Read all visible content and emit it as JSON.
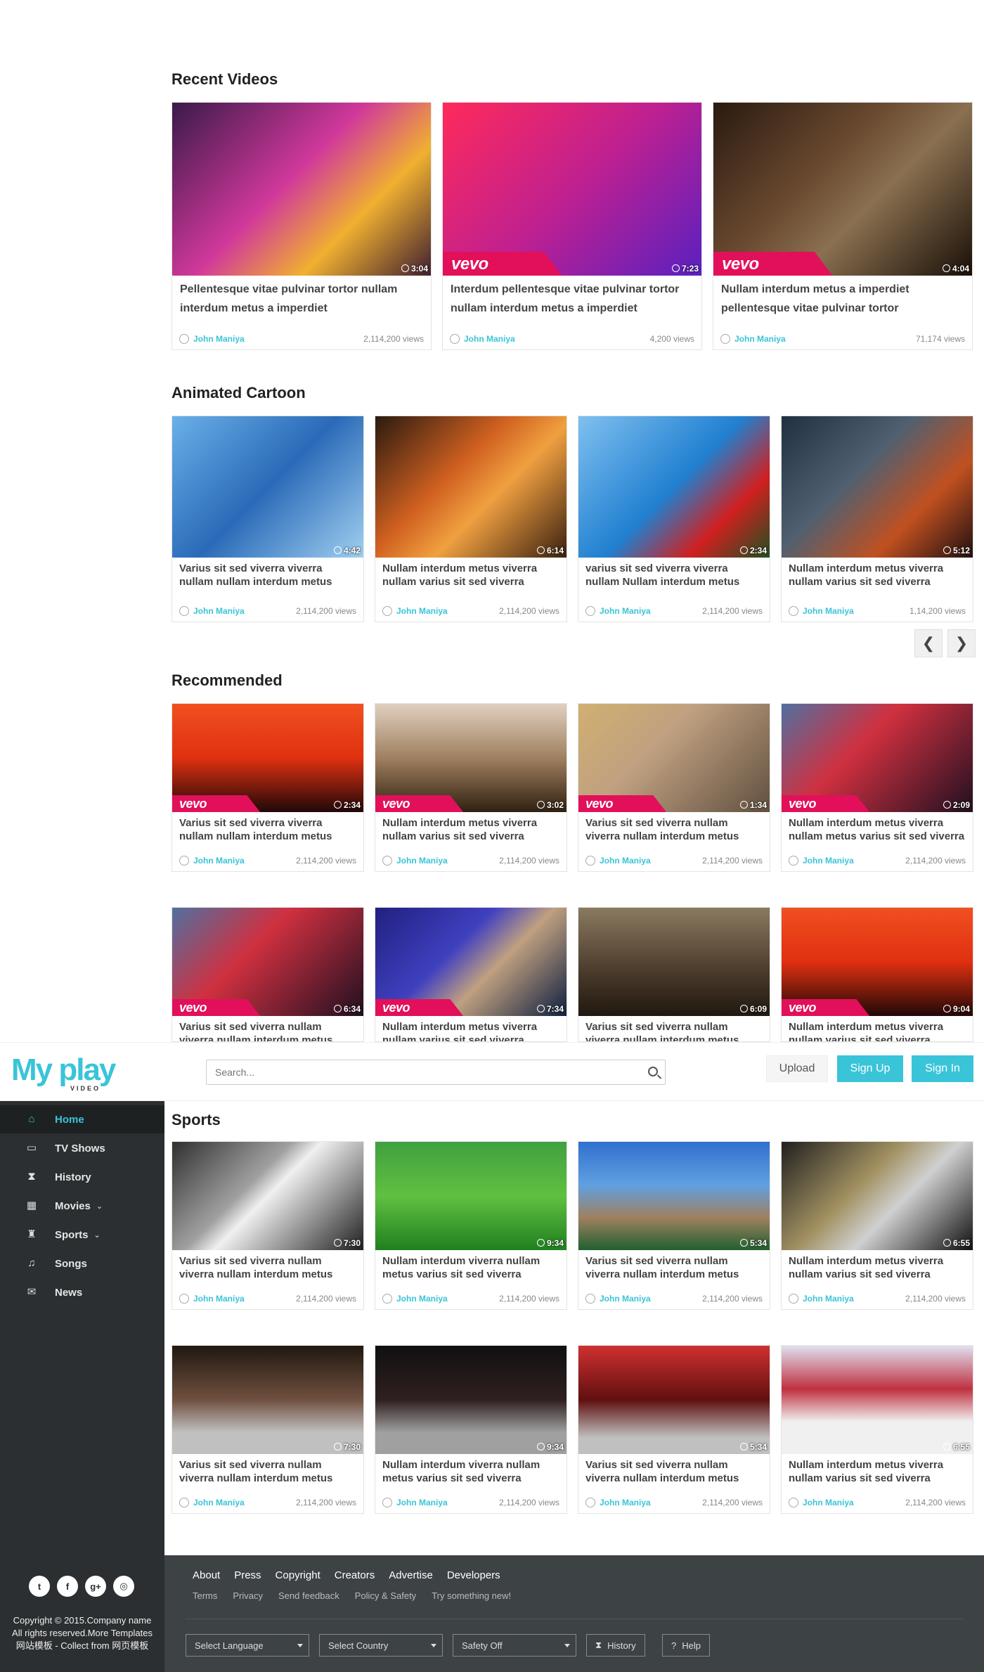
{
  "recent": {
    "title": "Recent Videos",
    "items": [
      {
        "title": "Pellentesque vitae pulvinar tortor nullam interdum metus a imperdiet",
        "author": "John Maniya",
        "views": "2,114,200 views",
        "duration": "3:04",
        "vevo": false
      },
      {
        "title": "Interdum pellentesque vitae pulvinar tortor nullam interdum metus a imperdiet",
        "author": "John Maniya",
        "views": "4,200 views",
        "duration": "7:23",
        "vevo": true
      },
      {
        "title": "Nullam interdum metus a imperdiet pellentesque vitae pulvinar tortor",
        "author": "John Maniya",
        "views": "71,174 views",
        "duration": "4:04",
        "vevo": true
      }
    ]
  },
  "cartoon": {
    "title": "Animated Cartoon",
    "items": [
      {
        "title": "Varius sit sed viverra viverra nullam nullam interdum metus",
        "author": "John Maniya",
        "views": "2,114,200 views",
        "duration": "4:42"
      },
      {
        "title": "Nullam interdum metus viverra nullam varius sit sed viverra",
        "author": "John Maniya",
        "views": "2,114,200 views",
        "duration": "6:14"
      },
      {
        "title": "varius sit sed viverra viverra nullam Nullam interdum metus",
        "author": "John Maniya",
        "views": "2,114,200 views",
        "duration": "2:34"
      },
      {
        "title": "Nullam interdum metus viverra nullam varius sit sed viverra",
        "author": "John Maniya",
        "views": "1,14,200 views",
        "duration": "5:12"
      }
    ],
    "prev": "❮",
    "next": "❯"
  },
  "recommended": {
    "title": "Recommended",
    "row1": [
      {
        "title": "Varius sit sed viverra viverra nullam nullam interdum metus",
        "author": "John Maniya",
        "views": "2,114,200 views",
        "duration": "2:34"
      },
      {
        "title": "Nullam interdum metus viverra nullam varius sit sed viverra",
        "author": "John Maniya",
        "views": "2,114,200 views",
        "duration": "3:02"
      },
      {
        "title": "Varius sit sed viverra nullam viverra nullam interdum metus",
        "author": "John Maniya",
        "views": "2,114,200 views",
        "duration": "1:34"
      },
      {
        "title": "Nullam interdum metus viverra nullam metus varius sit sed viverra",
        "author": "John Maniya",
        "views": "2,114,200 views",
        "duration": "2:09"
      }
    ],
    "row2": [
      {
        "title": "Varius sit sed viverra nullam viverra nullam interdum metus",
        "duration": "6:34"
      },
      {
        "title": "Nullam interdum metus viverra nullam varius sit sed viverra",
        "duration": "7:34"
      },
      {
        "title": "Varius sit sed viverra nullam viverra nullam interdum metus",
        "duration": "6:09"
      },
      {
        "title": "Nullam interdum metus viverra nullam varius sit sed viverra",
        "duration": "9:04"
      }
    ]
  },
  "header": {
    "logo": "My play",
    "logo_sub": "VIDEO",
    "search_placeholder": "Search...",
    "upload": "Upload",
    "signup": "Sign Up",
    "signin": "Sign In"
  },
  "sidebar": {
    "items": [
      {
        "label": "Home",
        "icon": "home-icon",
        "glyph": "⌂",
        "active": true
      },
      {
        "label": "TV Shows",
        "icon": "tv-icon",
        "glyph": "▭"
      },
      {
        "label": "History",
        "icon": "hourglass-icon",
        "glyph": "⧗"
      },
      {
        "label": "Movies",
        "icon": "film-icon",
        "glyph": "▦",
        "chevron": true
      },
      {
        "label": "Sports",
        "icon": "trophy-icon",
        "glyph": "♜",
        "chevron": true
      },
      {
        "label": "Songs",
        "icon": "music-icon",
        "glyph": "♫"
      },
      {
        "label": "News",
        "icon": "envelope-icon",
        "glyph": "✉"
      }
    ],
    "social": [
      {
        "name": "twitter-icon",
        "glyph": "t"
      },
      {
        "name": "facebook-icon",
        "glyph": "f"
      },
      {
        "name": "google-plus-icon",
        "glyph": "g+"
      },
      {
        "name": "dribbble-icon",
        "glyph": "◎"
      }
    ],
    "copyright": [
      "Copyright © 2015.Company name",
      "All rights reserved.More Templates",
      "网站模板 - Collect from 网页模板"
    ]
  },
  "sports": {
    "title": "Sports",
    "row1": [
      {
        "title": "Varius sit sed viverra nullam viverra nullam interdum metus",
        "author": "John Maniya",
        "views": "2,114,200 views",
        "duration": "7:30"
      },
      {
        "title": "Nullam interdum viverra nullam metus varius sit sed viverra",
        "author": "John Maniya",
        "views": "2,114,200 views",
        "duration": "9:34"
      },
      {
        "title": "Varius sit sed viverra nullam viverra nullam interdum metus",
        "author": "John Maniya",
        "views": "2,114,200 views",
        "duration": "5:34"
      },
      {
        "title": "Nullam interdum metus viverra nullam varius sit sed viverra",
        "author": "John Maniya",
        "views": "2,114,200 views",
        "duration": "6:55"
      }
    ],
    "row2": [
      {
        "title": "Varius sit sed viverra nullam viverra nullam interdum metus",
        "author": "John Maniya",
        "views": "2,114,200 views",
        "duration": "7:30"
      },
      {
        "title": "Nullam interdum viverra nullam metus varius sit sed viverra",
        "author": "John Maniya",
        "views": "2,114,200 views",
        "duration": "9:34"
      },
      {
        "title": "Varius sit sed viverra nullam viverra nullam interdum metus",
        "author": "John Maniya",
        "views": "2,114,200 views",
        "duration": "5:34"
      },
      {
        "title": "Nullam interdum metus viverra nullam varius sit sed viverra",
        "author": "John Maniya",
        "views": "2,114,200 views",
        "duration": "6:55"
      }
    ]
  },
  "footer": {
    "links": [
      "About",
      "Press",
      "Copyright",
      "Creators",
      "Advertise",
      "Developers"
    ],
    "sub_links": [
      "Terms",
      "Privacy",
      "Send feedback",
      "Policy & Safety",
      "Try something new!"
    ],
    "selects": [
      "Select Language",
      "Select Country",
      "Safety Off"
    ],
    "history": "History",
    "help": "Help"
  },
  "colors": {
    "accent": "#3ac4d8",
    "sidebar_bg": "#2b2f31",
    "footer_bg": "#3d4245",
    "vevo": "#e2105a"
  }
}
